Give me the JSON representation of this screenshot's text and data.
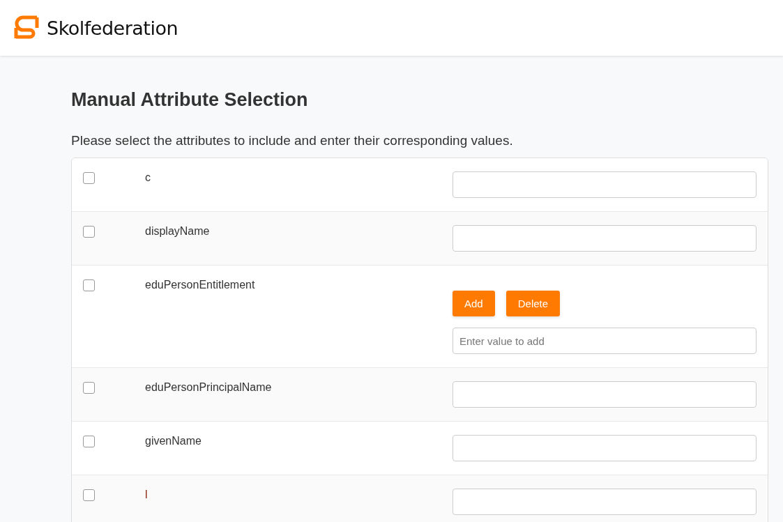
{
  "header": {
    "brand": "Skolfederation"
  },
  "heading": "Manual Attribute Selection",
  "intro": "Please select the attributes to include and enter their corresponding values.",
  "attributes": [
    {
      "name": "c",
      "checked": false,
      "kind": "text"
    },
    {
      "name": "displayName",
      "checked": false,
      "kind": "text"
    },
    {
      "name": "eduPersonEntitlement",
      "checked": false,
      "kind": "multi",
      "buttons": [
        "Add",
        "Delete"
      ],
      "placeholder": "Enter value to add"
    },
    {
      "name": "eduPersonPrincipalName",
      "checked": false,
      "kind": "text"
    },
    {
      "name": "givenName",
      "checked": false,
      "kind": "text"
    },
    {
      "name": "l",
      "checked": false,
      "kind": "text"
    }
  ]
}
